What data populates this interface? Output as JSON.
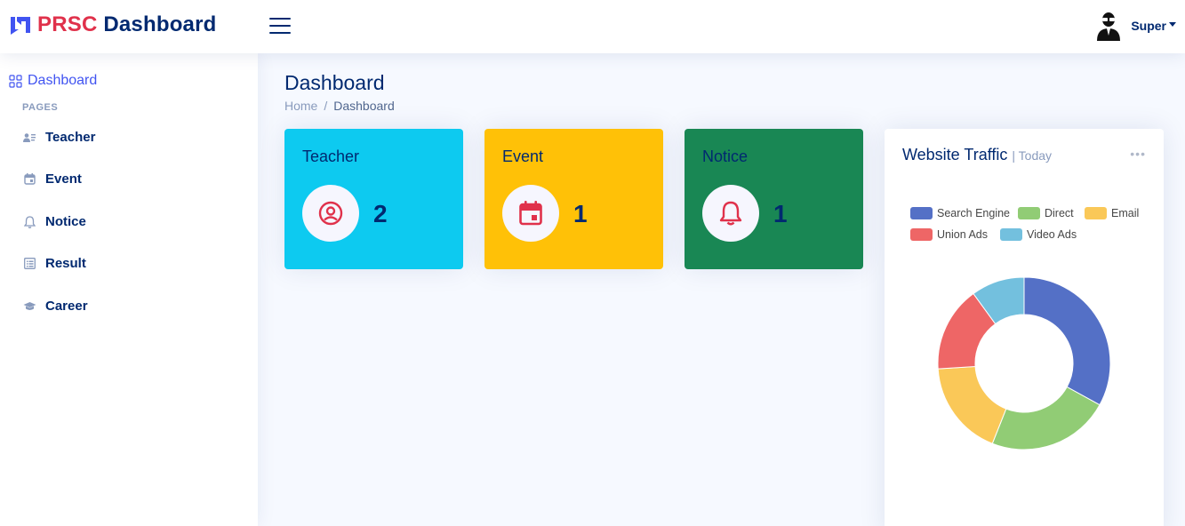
{
  "header": {
    "logo_accent": "PRSC",
    "logo_rest": " Dashboard",
    "user_name": "Super"
  },
  "sidebar": {
    "dashboard_label": "Dashboard",
    "section_heading": "PAGES",
    "items": [
      {
        "label": "Teacher",
        "icon": "person-lines-icon"
      },
      {
        "label": "Event",
        "icon": "calendar-icon"
      },
      {
        "label": "Notice",
        "icon": "bell-icon"
      },
      {
        "label": "Result",
        "icon": "list-icon"
      },
      {
        "label": "Career",
        "icon": "mortarboard-icon"
      }
    ]
  },
  "main": {
    "page_title": "Dashboard",
    "breadcrumb": {
      "home": "Home",
      "sep": "/",
      "current": "Dashboard"
    },
    "cards": [
      {
        "title": "Teacher",
        "value": "2",
        "color": "#0dcaf0",
        "icon": "person-circle-icon"
      },
      {
        "title": "Event",
        "value": "1",
        "color": "#ffc107",
        "icon": "calendar-event-icon"
      },
      {
        "title": "Notice",
        "value": "1",
        "color": "#198754",
        "icon": "bell-icon"
      }
    ],
    "traffic": {
      "title": "Website Traffic",
      "subtitle": "| Today",
      "more": "•••"
    }
  },
  "colors": {
    "brand": "#012970",
    "accent": "#e0314b",
    "link": "#4154f1",
    "card_icon": "#e0314b"
  },
  "chart_data": {
    "type": "pie",
    "donut": true,
    "legend": "top",
    "series": [
      {
        "name": "Search Engine",
        "value": 33,
        "color": "#5470c6"
      },
      {
        "name": "Direct",
        "value": 23,
        "color": "#91cc75"
      },
      {
        "name": "Email",
        "value": 18,
        "color": "#fac858"
      },
      {
        "name": "Union Ads",
        "value": 16,
        "color": "#ee6666"
      },
      {
        "name": "Video Ads",
        "value": 10,
        "color": "#73c0de"
      }
    ]
  }
}
